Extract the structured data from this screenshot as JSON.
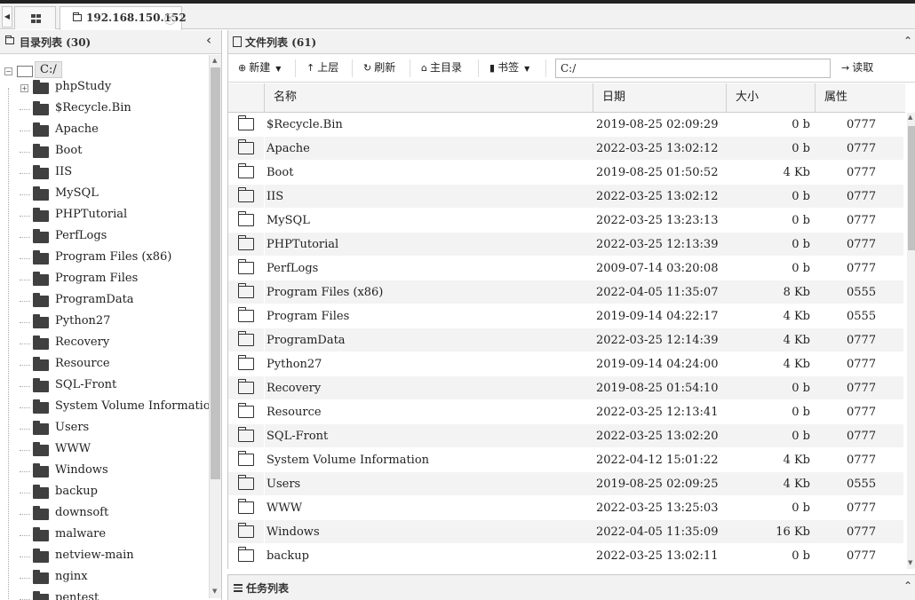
{
  "tabs": {
    "host_label": "192.168.150.152",
    "left_arrow": "◀",
    "close": "✕"
  },
  "left": {
    "title": "目录列表 (30)",
    "collapse": "‹",
    "root": "C:/",
    "tree": [
      "phpStudy",
      "$Recycle.Bin",
      "Apache",
      "Boot",
      "IIS",
      "MySQL",
      "PHPTutorial",
      "PerfLogs",
      "Program Files (x86)",
      "Program Files",
      "ProgramData",
      "Python27",
      "Recovery",
      "Resource",
      "SQL-Front",
      "System Volume Information",
      "Users",
      "WWW",
      "Windows",
      "backup",
      "downsoft",
      "malware",
      "netview-main",
      "nginx",
      "pentest"
    ],
    "expanded_marker": "−",
    "collapsed_marker": "+"
  },
  "right": {
    "title": "文件列表 (61)",
    "collapse": "⌃",
    "toolbar": {
      "new": "新建",
      "up": "上层",
      "refresh": "刷新",
      "home": "主目录",
      "bookmark": "书签",
      "path": "C:/",
      "read": "读取"
    },
    "columns": [
      "名称",
      "日期",
      "大小",
      "属性"
    ],
    "rows": [
      {
        "name": "$Recycle.Bin",
        "date": "2019-08-25 02:09:29",
        "size": "0 b",
        "attr": "0777"
      },
      {
        "name": "Apache",
        "date": "2022-03-25 13:02:12",
        "size": "0 b",
        "attr": "0777"
      },
      {
        "name": "Boot",
        "date": "2019-08-25 01:50:52",
        "size": "4 Kb",
        "attr": "0777"
      },
      {
        "name": "IIS",
        "date": "2022-03-25 13:02:12",
        "size": "0 b",
        "attr": "0777"
      },
      {
        "name": "MySQL",
        "date": "2022-03-25 13:23:13",
        "size": "0 b",
        "attr": "0777"
      },
      {
        "name": "PHPTutorial",
        "date": "2022-03-25 12:13:39",
        "size": "0 b",
        "attr": "0777"
      },
      {
        "name": "PerfLogs",
        "date": "2009-07-14 03:20:08",
        "size": "0 b",
        "attr": "0777"
      },
      {
        "name": "Program Files (x86)",
        "date": "2022-04-05 11:35:07",
        "size": "8 Kb",
        "attr": "0555"
      },
      {
        "name": "Program Files",
        "date": "2019-09-14 04:22:17",
        "size": "4 Kb",
        "attr": "0555"
      },
      {
        "name": "ProgramData",
        "date": "2022-03-25 12:14:39",
        "size": "4 Kb",
        "attr": "0777"
      },
      {
        "name": "Python27",
        "date": "2019-09-14 04:24:00",
        "size": "4 Kb",
        "attr": "0777"
      },
      {
        "name": "Recovery",
        "date": "2019-08-25 01:54:10",
        "size": "0 b",
        "attr": "0777"
      },
      {
        "name": "Resource",
        "date": "2022-03-25 12:13:41",
        "size": "0 b",
        "attr": "0777"
      },
      {
        "name": "SQL-Front",
        "date": "2022-03-25 13:02:20",
        "size": "0 b",
        "attr": "0777"
      },
      {
        "name": "System Volume Information",
        "date": "2022-04-12 15:01:22",
        "size": "4 Kb",
        "attr": "0777"
      },
      {
        "name": "Users",
        "date": "2019-08-25 02:09:25",
        "size": "4 Kb",
        "attr": "0555"
      },
      {
        "name": "WWW",
        "date": "2022-03-25 13:25:03",
        "size": "0 b",
        "attr": "0777"
      },
      {
        "name": "Windows",
        "date": "2022-04-05 11:35:09",
        "size": "16 Kb",
        "attr": "0777"
      },
      {
        "name": "backup",
        "date": "2022-03-25 13:02:11",
        "size": "0 b",
        "attr": "0777"
      }
    ]
  },
  "tasks": {
    "title": "任务列表",
    "collapse": "⌃"
  }
}
